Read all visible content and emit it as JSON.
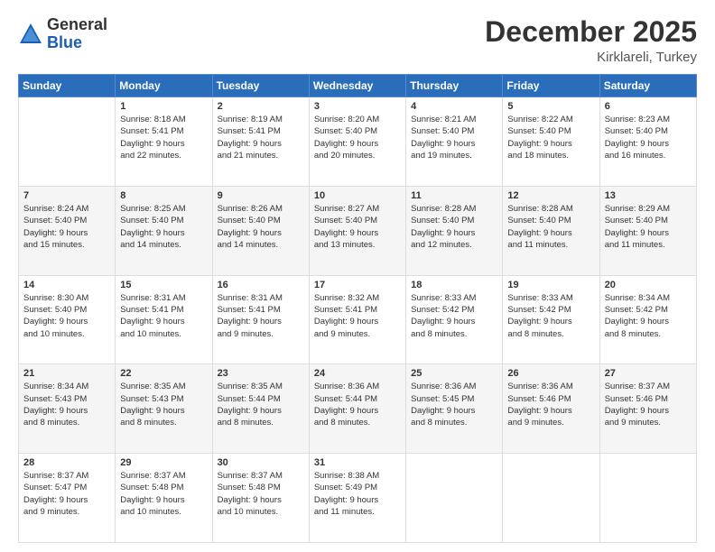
{
  "header": {
    "logo_general": "General",
    "logo_blue": "Blue",
    "month_year": "December 2025",
    "location": "Kirklareli, Turkey"
  },
  "days_of_week": [
    "Sunday",
    "Monday",
    "Tuesday",
    "Wednesday",
    "Thursday",
    "Friday",
    "Saturday"
  ],
  "weeks": [
    [
      {
        "day": "",
        "info": ""
      },
      {
        "day": "1",
        "info": "Sunrise: 8:18 AM\nSunset: 5:41 PM\nDaylight: 9 hours\nand 22 minutes."
      },
      {
        "day": "2",
        "info": "Sunrise: 8:19 AM\nSunset: 5:41 PM\nDaylight: 9 hours\nand 21 minutes."
      },
      {
        "day": "3",
        "info": "Sunrise: 8:20 AM\nSunset: 5:40 PM\nDaylight: 9 hours\nand 20 minutes."
      },
      {
        "day": "4",
        "info": "Sunrise: 8:21 AM\nSunset: 5:40 PM\nDaylight: 9 hours\nand 19 minutes."
      },
      {
        "day": "5",
        "info": "Sunrise: 8:22 AM\nSunset: 5:40 PM\nDaylight: 9 hours\nand 18 minutes."
      },
      {
        "day": "6",
        "info": "Sunrise: 8:23 AM\nSunset: 5:40 PM\nDaylight: 9 hours\nand 16 minutes."
      }
    ],
    [
      {
        "day": "7",
        "info": "Sunrise: 8:24 AM\nSunset: 5:40 PM\nDaylight: 9 hours\nand 15 minutes."
      },
      {
        "day": "8",
        "info": "Sunrise: 8:25 AM\nSunset: 5:40 PM\nDaylight: 9 hours\nand 14 minutes."
      },
      {
        "day": "9",
        "info": "Sunrise: 8:26 AM\nSunset: 5:40 PM\nDaylight: 9 hours\nand 14 minutes."
      },
      {
        "day": "10",
        "info": "Sunrise: 8:27 AM\nSunset: 5:40 PM\nDaylight: 9 hours\nand 13 minutes."
      },
      {
        "day": "11",
        "info": "Sunrise: 8:28 AM\nSunset: 5:40 PM\nDaylight: 9 hours\nand 12 minutes."
      },
      {
        "day": "12",
        "info": "Sunrise: 8:28 AM\nSunset: 5:40 PM\nDaylight: 9 hours\nand 11 minutes."
      },
      {
        "day": "13",
        "info": "Sunrise: 8:29 AM\nSunset: 5:40 PM\nDaylight: 9 hours\nand 11 minutes."
      }
    ],
    [
      {
        "day": "14",
        "info": "Sunrise: 8:30 AM\nSunset: 5:40 PM\nDaylight: 9 hours\nand 10 minutes."
      },
      {
        "day": "15",
        "info": "Sunrise: 8:31 AM\nSunset: 5:41 PM\nDaylight: 9 hours\nand 10 minutes."
      },
      {
        "day": "16",
        "info": "Sunrise: 8:31 AM\nSunset: 5:41 PM\nDaylight: 9 hours\nand 9 minutes."
      },
      {
        "day": "17",
        "info": "Sunrise: 8:32 AM\nSunset: 5:41 PM\nDaylight: 9 hours\nand 9 minutes."
      },
      {
        "day": "18",
        "info": "Sunrise: 8:33 AM\nSunset: 5:42 PM\nDaylight: 9 hours\nand 8 minutes."
      },
      {
        "day": "19",
        "info": "Sunrise: 8:33 AM\nSunset: 5:42 PM\nDaylight: 9 hours\nand 8 minutes."
      },
      {
        "day": "20",
        "info": "Sunrise: 8:34 AM\nSunset: 5:42 PM\nDaylight: 9 hours\nand 8 minutes."
      }
    ],
    [
      {
        "day": "21",
        "info": "Sunrise: 8:34 AM\nSunset: 5:43 PM\nDaylight: 9 hours\nand 8 minutes."
      },
      {
        "day": "22",
        "info": "Sunrise: 8:35 AM\nSunset: 5:43 PM\nDaylight: 9 hours\nand 8 minutes."
      },
      {
        "day": "23",
        "info": "Sunrise: 8:35 AM\nSunset: 5:44 PM\nDaylight: 9 hours\nand 8 minutes."
      },
      {
        "day": "24",
        "info": "Sunrise: 8:36 AM\nSunset: 5:44 PM\nDaylight: 9 hours\nand 8 minutes."
      },
      {
        "day": "25",
        "info": "Sunrise: 8:36 AM\nSunset: 5:45 PM\nDaylight: 9 hours\nand 8 minutes."
      },
      {
        "day": "26",
        "info": "Sunrise: 8:36 AM\nSunset: 5:46 PM\nDaylight: 9 hours\nand 9 minutes."
      },
      {
        "day": "27",
        "info": "Sunrise: 8:37 AM\nSunset: 5:46 PM\nDaylight: 9 hours\nand 9 minutes."
      }
    ],
    [
      {
        "day": "28",
        "info": "Sunrise: 8:37 AM\nSunset: 5:47 PM\nDaylight: 9 hours\nand 9 minutes."
      },
      {
        "day": "29",
        "info": "Sunrise: 8:37 AM\nSunset: 5:48 PM\nDaylight: 9 hours\nand 10 minutes."
      },
      {
        "day": "30",
        "info": "Sunrise: 8:37 AM\nSunset: 5:48 PM\nDaylight: 9 hours\nand 10 minutes."
      },
      {
        "day": "31",
        "info": "Sunrise: 8:38 AM\nSunset: 5:49 PM\nDaylight: 9 hours\nand 11 minutes."
      },
      {
        "day": "",
        "info": ""
      },
      {
        "day": "",
        "info": ""
      },
      {
        "day": "",
        "info": ""
      }
    ]
  ]
}
